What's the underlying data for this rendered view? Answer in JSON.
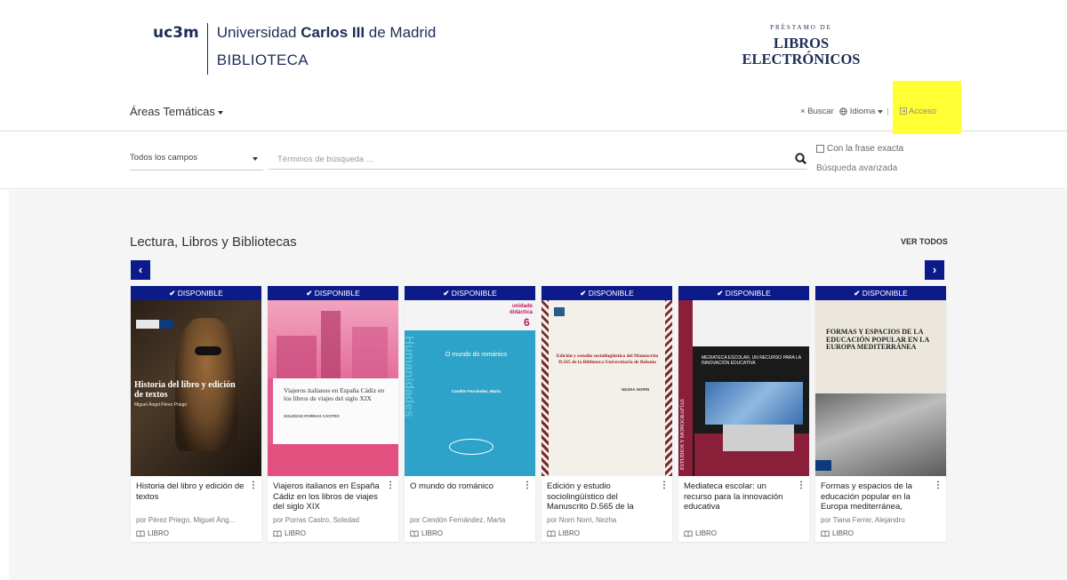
{
  "header": {
    "logo_mark": "uc3m",
    "university_prefix": "Universidad ",
    "university_bold": "Carlos III",
    "university_suffix": " de Madrid",
    "library": "BIBLIOTECA",
    "brand_small": "PRÉSTAMO DE",
    "brand_line1": "LIBROS",
    "brand_line2": "ELECTRÓNICOS"
  },
  "nav": {
    "areas_label": "Áreas Temáticas",
    "search_label": "× Buscar",
    "language_label": "Idioma",
    "access_label": "Acceso",
    "access_icon": "login-icon",
    "language_icon": "globe-icon"
  },
  "search": {
    "field_value": "Todos los campos",
    "placeholder": "Términos de búsqueda ...",
    "exact_label": "Con la frase exacta",
    "advanced_label": "Búsqueda avanzada"
  },
  "section": {
    "title": "Lectura, Libros y Bibliotecas",
    "see_all": "VER TODOS",
    "prev": "‹",
    "next": "›"
  },
  "books": [
    {
      "status": "DISPONIBLE",
      "title": "Historia del libro y edición de textos",
      "author": "por Pérez Priego, Miguel Áng...",
      "format": "LIBRO"
    },
    {
      "status": "DISPONIBLE",
      "title": "Viajeros italianos en España Cádiz en los libros de viajes del siglo XIX",
      "author": "por Porras Castro, Soledad",
      "format": "LIBRO"
    },
    {
      "status": "DISPONIBLE",
      "title": "O mundo do románico",
      "author": "por Cendón Fernández, Marta",
      "format": "LIBRO"
    },
    {
      "status": "DISPONIBLE",
      "title": "Edición y estudio sociolingüístico del Manuscrito D.565 de la",
      "author": "por Norri Norri, Nezha",
      "format": "LIBRO"
    },
    {
      "status": "DISPONIBLE",
      "title": "Mediateca escolar: un recurso para la innovación educativa",
      "author": "",
      "format": "LIBRO"
    },
    {
      "status": "DISPONIBLE",
      "title": "Formas y espacios de la educación popular en la Europa mediterránea,",
      "author": "por Tiana Ferrer, Alejandro",
      "format": "LIBRO"
    }
  ],
  "covers": {
    "c1": {
      "title": "Historia del libro y edición de textos",
      "author": "Miguel Ángel Pérez Priego"
    },
    "c2": {
      "title": "Viajeros italianos en España Cádiz en los libros de viajes del siglo XIX",
      "author": "SOLEDAD PORRAS CASTRO"
    },
    "c3": {
      "badge": "unidade didáctica",
      "num": "6",
      "title": "O mundo do románico",
      "author": "Cendón Fernández, Marta",
      "side": "Humanidades"
    },
    "c4": {
      "title": "Edición y estudio sociolingüístico del Manuscrito D.565 de la Biblioteca Universitaria de Bolonia",
      "author": "NEZHA NORRI"
    },
    "c5": {
      "side": "ESTUDIOS Y MONOGRAFÍAS",
      "title": "MEDIATECA ESCOLAR, UN RECURSO PARA LA INNOVACIÓN EDUCATIVA"
    },
    "c6": {
      "title": "FORMAS Y ESPACIOS DE LA EDUCACIÓN POPULAR EN LA EUROPA MEDITERRÁNEA"
    }
  },
  "colors": {
    "navy": "#0c1a8a",
    "brand": "#1c2d56",
    "highlight": "#ffff33"
  }
}
